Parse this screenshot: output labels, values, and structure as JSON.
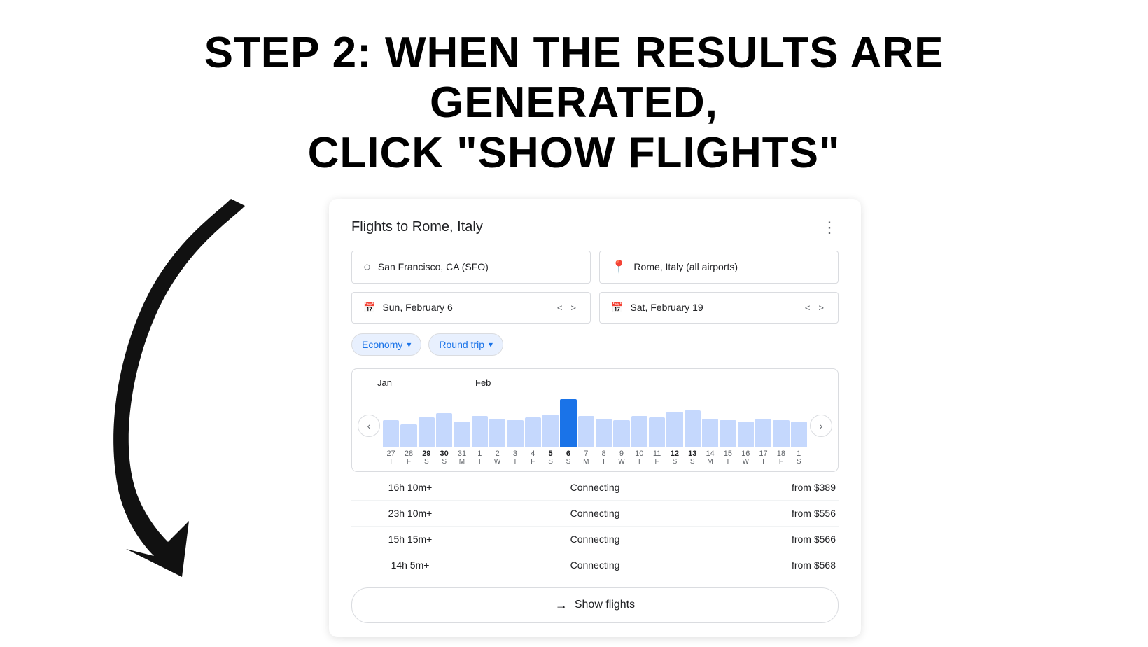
{
  "page": {
    "title_line1": "STEP 2: WHEN THE RESULTS ARE GENERATED,",
    "title_line2": "CLICK \"SHOW FLIGHTS\""
  },
  "card": {
    "title": "Flights to Rome, Italy",
    "menu_icon": "⋮"
  },
  "origin_field": {
    "value": "San Francisco, CA (SFO)"
  },
  "destination_field": {
    "value": "Rome, Italy (all airports)"
  },
  "depart_date": {
    "value": "Sun, February 6"
  },
  "return_date": {
    "value": "Sat, February 19"
  },
  "filters": {
    "cabin": "Economy",
    "trip_type": "Round trip"
  },
  "chart": {
    "months": [
      "Jan",
      "Feb"
    ],
    "date_labels": [
      "27",
      "28",
      "29",
      "30",
      "31",
      "1",
      "2",
      "3",
      "4",
      "5",
      "6",
      "7",
      "8",
      "9",
      "10",
      "11",
      "12",
      "13",
      "14",
      "15",
      "16",
      "17",
      "18",
      "1"
    ],
    "day_letters": [
      "T",
      "F",
      "S",
      "S",
      "M",
      "T",
      "W",
      "T",
      "F",
      "S",
      "S",
      "M",
      "T",
      "W",
      "T",
      "F",
      "S",
      "S",
      "M",
      "T",
      "W",
      "T",
      "F",
      "S"
    ],
    "bold_dates": [
      "29",
      "30",
      "5",
      "6",
      "12",
      "13"
    ],
    "selected_date": "6"
  },
  "flights": [
    {
      "duration": "16h 10m+",
      "type": "Connecting",
      "price": "from $389"
    },
    {
      "duration": "23h 10m+",
      "type": "Connecting",
      "price": "from $556"
    },
    {
      "duration": "15h 15m+",
      "type": "Connecting",
      "price": "from $566"
    },
    {
      "duration": "14h 5m+",
      "type": "Connecting",
      "price": "from $568"
    }
  ],
  "show_flights_button": {
    "label": "Show flights",
    "arrow": "→"
  }
}
